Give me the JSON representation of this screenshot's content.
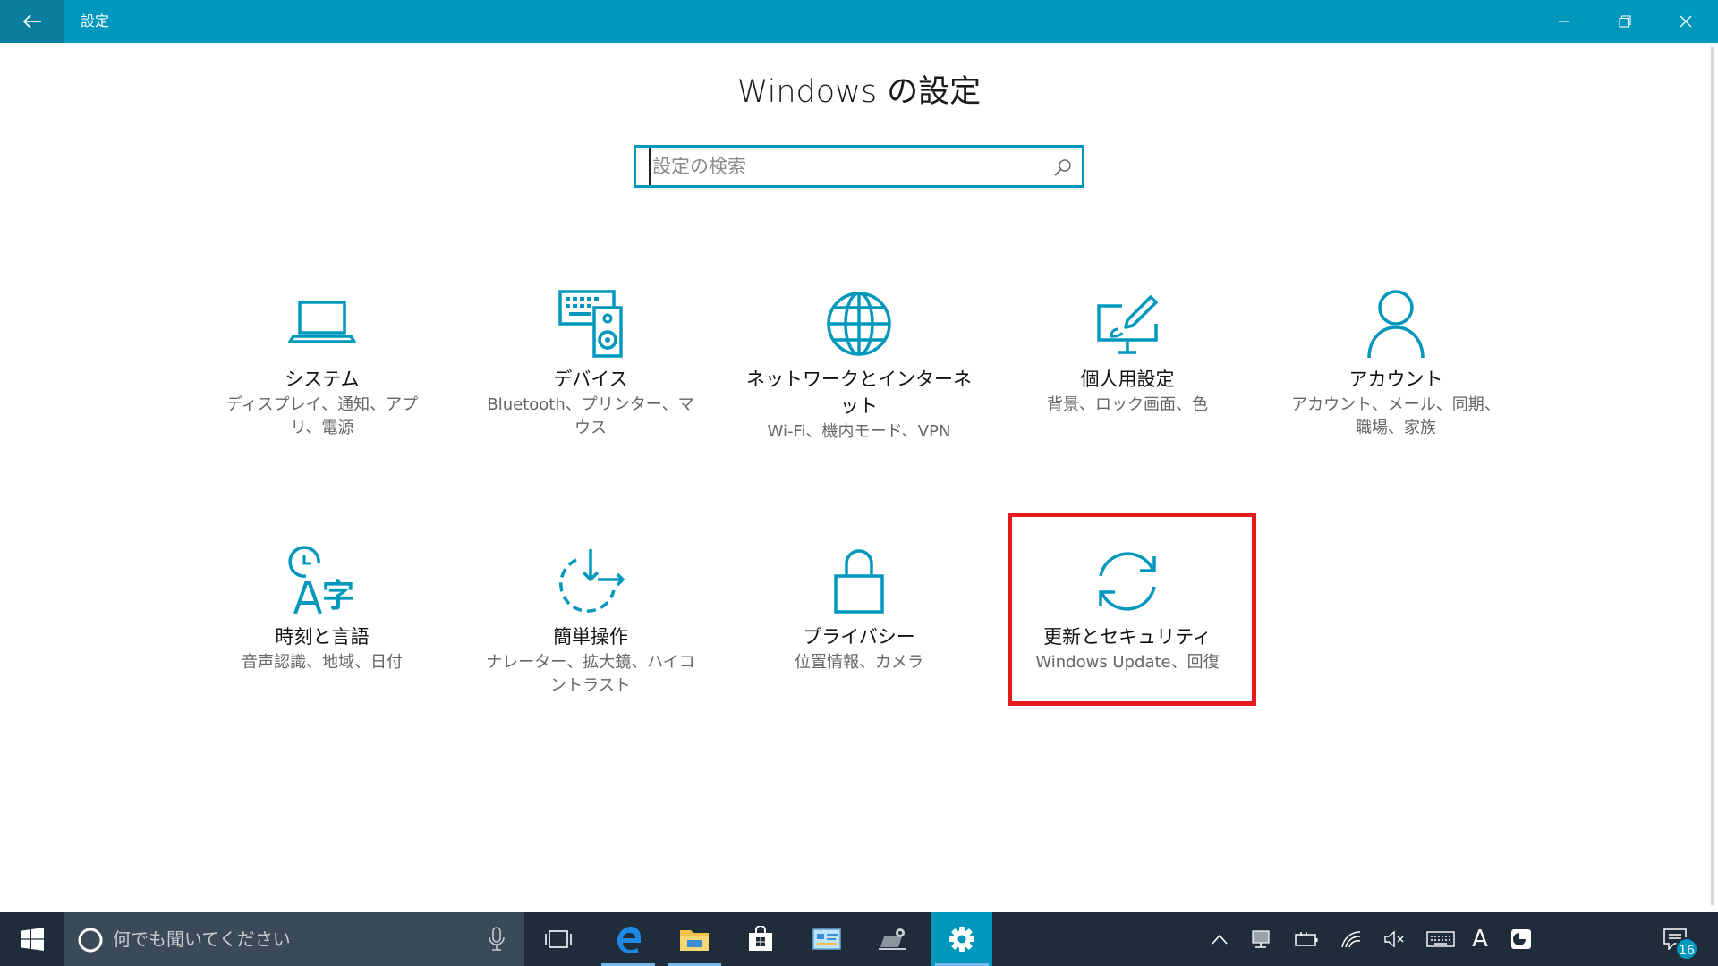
{
  "window": {
    "title": "設定",
    "minimize_icon": "minimize-icon",
    "restore_icon": "restore-icon",
    "close_icon": "close-icon"
  },
  "header": {
    "title": "Windows の設定"
  },
  "search": {
    "placeholder": "設定の検索"
  },
  "tiles": [
    {
      "title": "システム",
      "desc": "ディスプレイ、通知、アプリ、電源",
      "icon": "laptop-icon"
    },
    {
      "title": "デバイス",
      "desc": "Bluetooth、プリンター、マウス",
      "icon": "devices-icon"
    },
    {
      "title": "ネットワークとインターネット",
      "desc": "Wi-Fi、機内モード、VPN",
      "icon": "globe-icon"
    },
    {
      "title": "個人用設定",
      "desc": "背景、ロック画面、色",
      "icon": "personalization-icon"
    },
    {
      "title": "アカウント",
      "desc": "アカウント、メール、同期、職場、家族",
      "icon": "person-icon"
    },
    {
      "title": "時刻と言語",
      "desc": "音声認識、地域、日付",
      "icon": "time-language-icon"
    },
    {
      "title": "簡単操作",
      "desc": "ナレーター、拡大鏡、ハイコントラスト",
      "icon": "ease-of-access-icon"
    },
    {
      "title": "プライバシー",
      "desc": "位置情報、カメラ",
      "icon": "lock-icon"
    },
    {
      "title": "更新とセキュリティ",
      "desc": "Windows Update、回復",
      "icon": "sync-icon"
    }
  ],
  "taskbar": {
    "search_placeholder": "何でも聞いてください",
    "notification_count": "16",
    "ime_label": "A",
    "accent": "#0097bd"
  }
}
